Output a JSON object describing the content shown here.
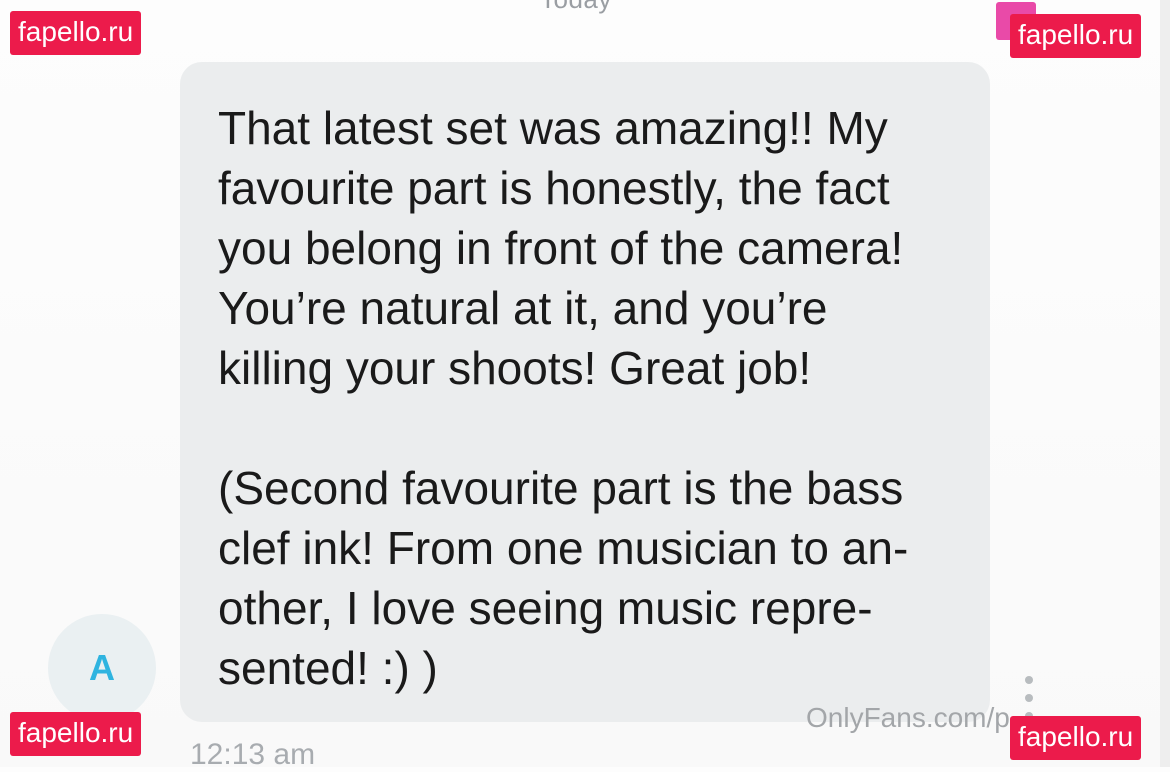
{
  "header": {
    "date_label": "Today"
  },
  "message": {
    "text": "That latest set was amazing!! My\nfavourite part is honestly, the fact\nyou belong in front of the camera!\nYou’re natural at it, and you’re\nkilling your shoots! Great job!\n\n(Second favourite part is the bass\nclef ink! From one musician to an-\nother, I love seeing music repre-\nsented! :) )",
    "timestamp": "12:13 am",
    "sender_initial": "A"
  },
  "icons": {
    "more": "more-vertical-icon"
  },
  "watermarks": {
    "source_url": "OnlyFans.com/p",
    "badge_label": "fapello.ru"
  },
  "colors": {
    "bubble_bg": "#ebedee",
    "avatar_letter": "#2fb4e0",
    "watermark_bg": "#ec1b4b"
  }
}
